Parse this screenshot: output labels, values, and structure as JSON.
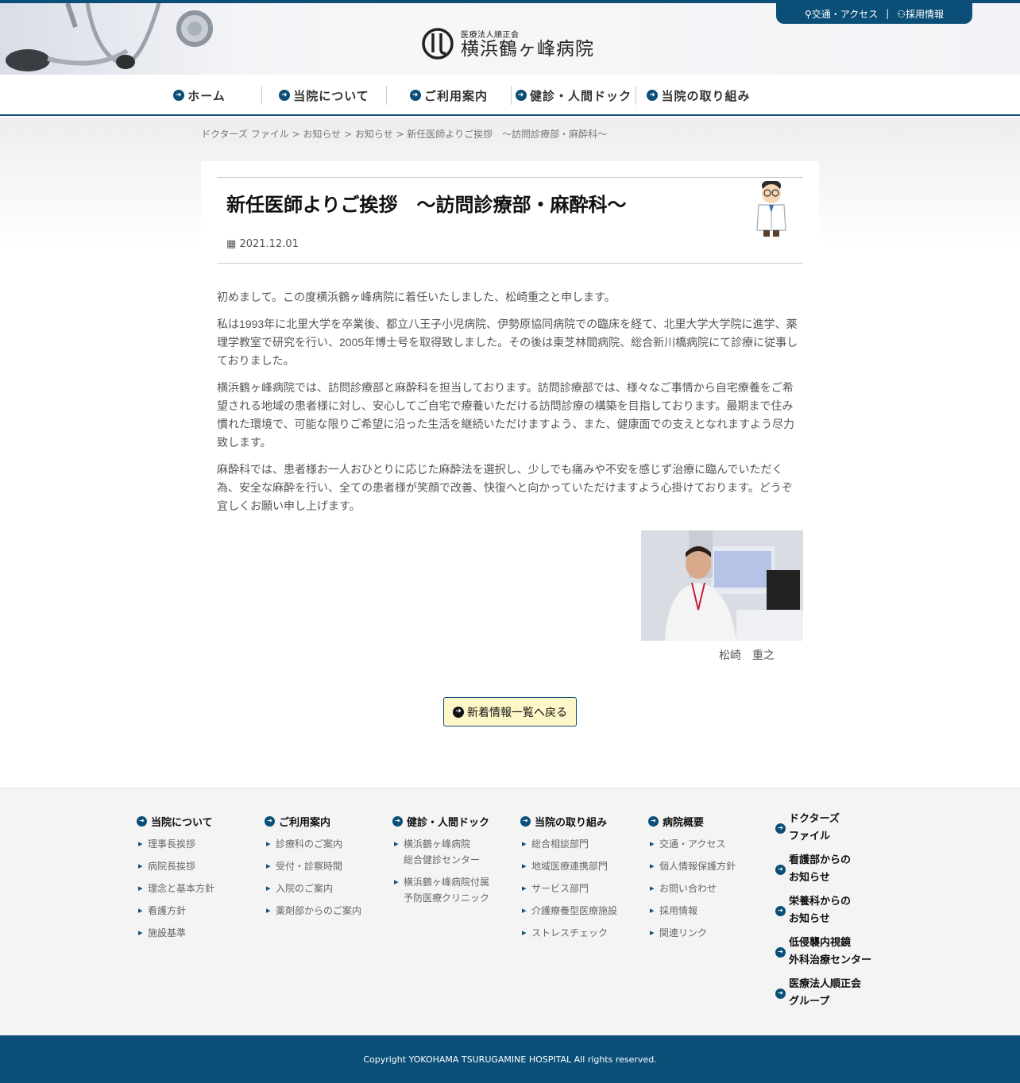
{
  "header": {
    "top_links": {
      "access": "交通・アクセス",
      "separator": "|",
      "recruit": "採用情報"
    },
    "logo": {
      "sub": "医療法人順正会",
      "main": "横浜鶴ヶ峰病院"
    }
  },
  "nav": {
    "items": [
      {
        "label": "ホーム"
      },
      {
        "label": "当院について"
      },
      {
        "label": "ご利用案内"
      },
      {
        "label": "健診・人間ドック"
      },
      {
        "label": "当院の取り組み"
      }
    ]
  },
  "breadcrumb": "ドクターズ ファイル > お知らせ > お知らせ > 新任医師よりご挨拶　～訪問診療部・麻酔科～",
  "article": {
    "title": "新任医師よりご挨拶　～訪問診療部・麻酔科～",
    "date": "2021.12.01",
    "paragraphs": [
      "初めまして。この度横浜鶴ヶ峰病院に着任いたしました、松崎重之と申します。",
      "私は1993年に北里大学を卒業後、都立八王子小児病院、伊勢原協同病院での臨床を経て、北里大学大学院に進学、薬理学教室で研究を行い、2005年博士号を取得致しました。その後は東芝林間病院、総合新川橋病院にて診療に従事しておりました。",
      "横浜鶴ヶ峰病院では、訪問診療部と麻酔科を担当しております。訪問診療部では、様々なご事情から自宅療養をご希望される地域の患者様に対し、安心してご自宅で療養いただける訪問診療の構築を目指しております。最期まで住み慣れた環境で、可能な限りご希望に沿った生活を継続いただけますよう、また、健康面での支えとなれますよう尽力致します。",
      "麻酔科では、患者様お一人おひとりに応じた麻酔法を選択し、少しでも痛みや不安を感じず治療に臨んでいただく為、安全な麻酔を行い、全ての患者様が笑顔で改善、快復へと向かっていただけますよう心掛けております。どうぞ宜しくお願い申し上げます。"
    ],
    "photo_caption": "松崎　重之",
    "back_button": "新着情報一覧へ戻る"
  },
  "footer": {
    "columns": [
      {
        "heading": "当院について",
        "items": [
          "理事長挨拶",
          "病院長挨拶",
          "理念と基本方針",
          "看護方針",
          "施設基準"
        ]
      },
      {
        "heading": "ご利用案内",
        "items": [
          "診療科のご案内",
          "受付・診察時間",
          "入院のご案内",
          "薬剤部からのご案内"
        ]
      },
      {
        "heading": "健診・人間ドック",
        "items": [
          "横浜鶴ヶ峰病院\n総合健診センター",
          "横浜鶴ヶ峰病院付属\n予防医療クリニック"
        ]
      },
      {
        "heading": "当院の取り組み",
        "items": [
          "総合相談部門",
          "地域医療連携部門",
          "サービス部門",
          "介護療養型医療施設",
          "ストレスチェック"
        ]
      },
      {
        "heading": "病院概要",
        "items": [
          "交通・アクセス",
          "個人情報保護方針",
          "お問い合わせ",
          "採用情報",
          "関連リンク"
        ]
      }
    ],
    "side_links": [
      "ドクターズ\nファイル",
      "看護部からの\nお知らせ",
      "栄養科からの\nお知らせ",
      "低侵襲内視鏡\n外科治療センター",
      "医療法人順正会\nグループ"
    ],
    "copyright": "Copyright YOKOHAMA TSURUGAMINE HOSPITAL All rights reserved."
  },
  "colors": {
    "brand": "#0b4f78",
    "button_bg": "#fdf6c8"
  },
  "icons": {
    "nav": "circle-arrow-right-icon",
    "date": "calendar-icon",
    "access": "map-pin-icon",
    "recruit": "people-icon"
  }
}
